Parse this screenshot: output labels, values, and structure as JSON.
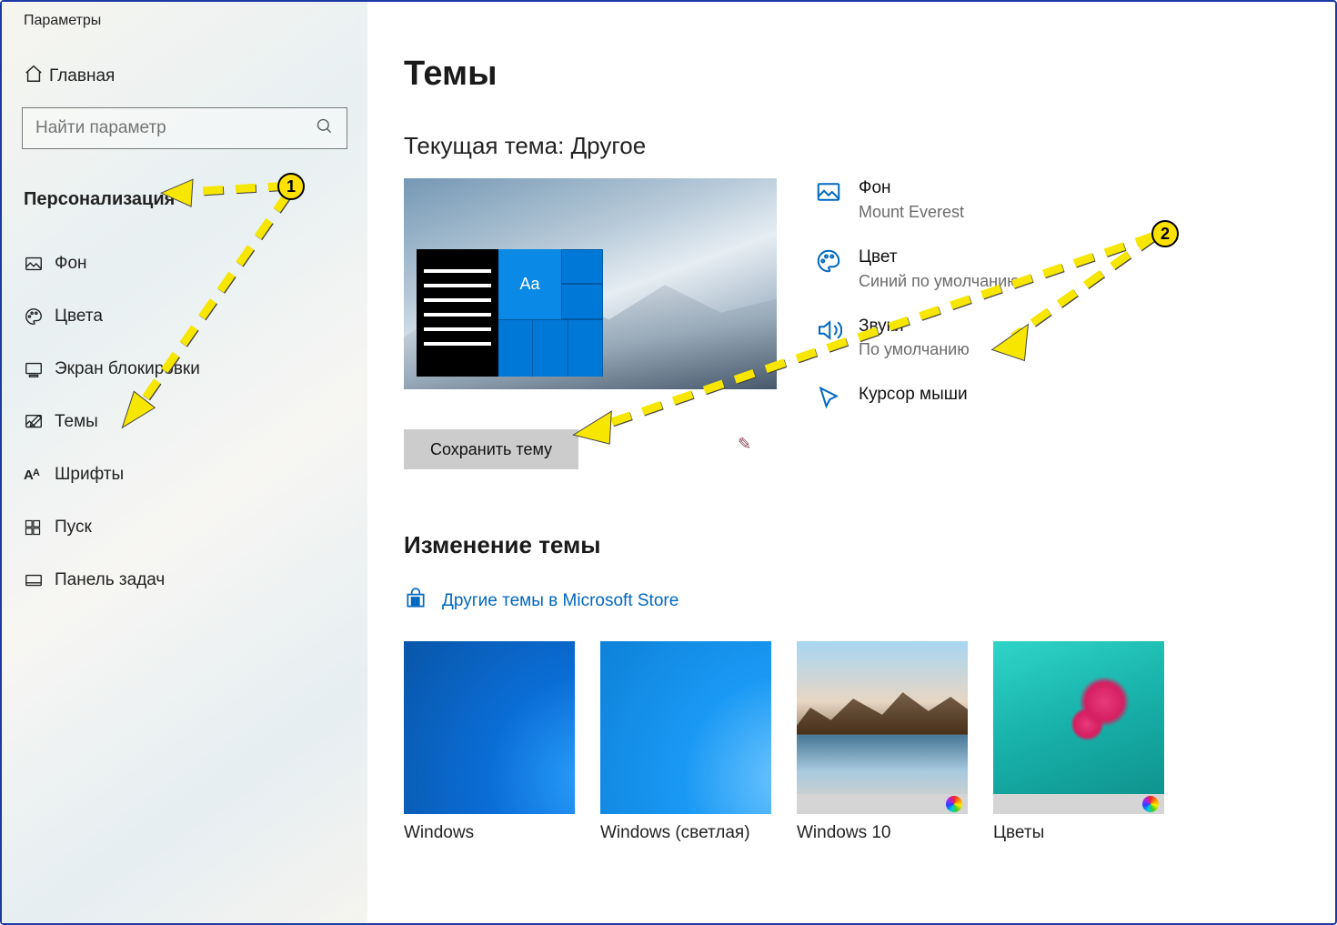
{
  "window_title": "Параметры",
  "sidebar": {
    "home": "Главная",
    "search_placeholder": "Найти параметр",
    "category": "Персонализация",
    "items": [
      {
        "id": "bg",
        "label": "Фон"
      },
      {
        "id": "color",
        "label": "Цвета"
      },
      {
        "id": "lock",
        "label": "Экран блокировки"
      },
      {
        "id": "theme",
        "label": "Темы"
      },
      {
        "id": "font",
        "label": "Шрифты"
      },
      {
        "id": "start",
        "label": "Пуск"
      },
      {
        "id": "task",
        "label": "Панель задач"
      }
    ]
  },
  "page": {
    "title": "Темы",
    "current_theme_label": "Текущая тема:",
    "current_theme_value": "Другое",
    "preview_sample": "Aa",
    "save_button": "Сохранить тему",
    "props": {
      "bg": {
        "label": "Фон",
        "value": "Mount Everest"
      },
      "color": {
        "label": "Цвет",
        "value": "Синий по умолчанию"
      },
      "sound": {
        "label": "Звуки",
        "value": "По умолчанию"
      },
      "cursor": {
        "label": "Курсор мыши",
        "value": ""
      }
    },
    "change_header": "Изменение темы",
    "store_link": "Другие темы в Microsoft Store",
    "themes": [
      {
        "id": "win",
        "name": "Windows",
        "slideshow": false
      },
      {
        "id": "winlight",
        "name": "Windows (светлая)",
        "slideshow": false
      },
      {
        "id": "win10",
        "name": "Windows 10",
        "slideshow": true
      },
      {
        "id": "flowers",
        "name": "Цветы",
        "slideshow": true
      }
    ]
  },
  "annotations": {
    "badge1": "1",
    "badge2": "2"
  }
}
